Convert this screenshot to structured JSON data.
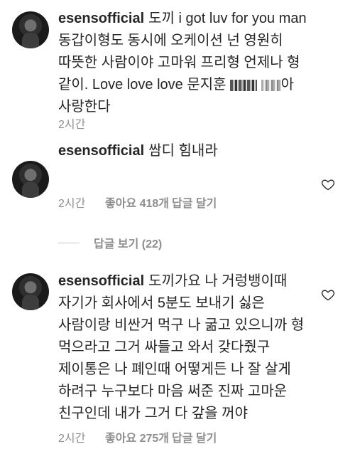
{
  "comments": [
    {
      "username": "esensofficial",
      "text_before_redaction": "도끼 i got luv for you man 동갑이형도 동시에 오케이션 넌 영원히 따뜻한 사람이야 고마워 프리형 언제나 형 같이. Love love love 문지훈",
      "text_after_redaction": "아 사랑한다",
      "time": "2시간"
    },
    {
      "username": "esensofficial",
      "text": "쌈디 힘내라",
      "time": "2시간",
      "likes": "좋아요 418개",
      "reply": "답글 달기"
    },
    {
      "username": "esensofficial",
      "text": "도끼가요 나 거렁뱅이때 자기가 회사에서 5분도 보내기 싫은 사람이랑 비싼거 먹구 나 굶고 있으니까 형 먹으라고 그거 싸들고 와서 갖다줬구 제이통은 나 폐인때 어떻게든 나 잘 살게 하려구 누구보다 마음 써준 진짜 고마운 친구인데 내가 그거 다 갚을 꺼야",
      "time": "2시간",
      "likes": "좋아요 275개",
      "reply": "답글 달기"
    }
  ],
  "view_replies": "답글 보기 (22)",
  "icons": {
    "avatar": "profile-photo",
    "heart": "heart-outline-icon"
  }
}
